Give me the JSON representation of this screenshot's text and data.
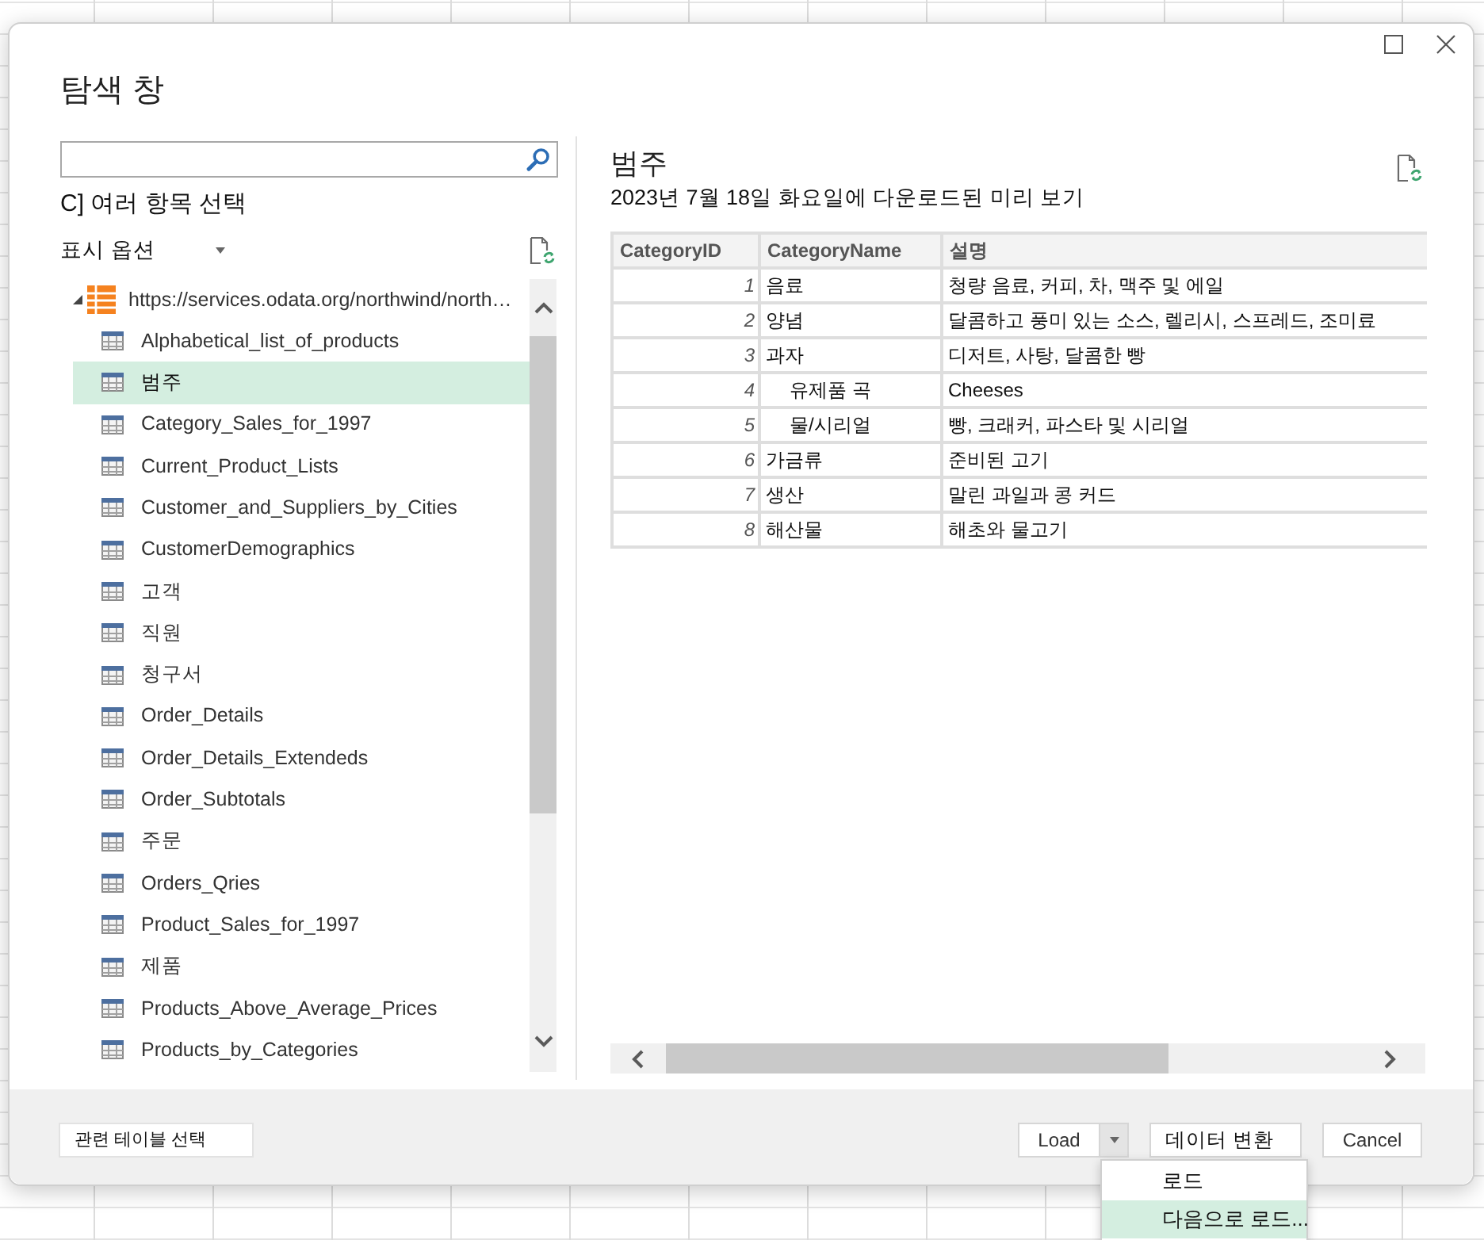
{
  "window": {
    "title": "탐색 창"
  },
  "navigator": {
    "multi_select_label": "C] 여러 항목 선택",
    "display_options": {
      "label": "표시 옵션"
    },
    "tree": {
      "label": "https://services.odata.org/northwind/north…",
      "expanded": true,
      "children": [
        {
          "label": "Alphabetical_list_of_products",
          "selected": false
        },
        {
          "label": "범주",
          "selected": true
        },
        {
          "label": "Category_Sales_for_1997",
          "selected": false
        },
        {
          "label": "Current_Product_Lists",
          "selected": false
        },
        {
          "label": "Customer_and_Suppliers_by_Cities",
          "selected": false
        },
        {
          "label": "CustomerDemographics",
          "selected": false
        },
        {
          "label": "고객",
          "selected": false
        },
        {
          "label": "직원",
          "selected": false
        },
        {
          "label": "청구서",
          "selected": false
        },
        {
          "label": "Order_Details",
          "selected": false
        },
        {
          "label": "Order_Details_Extendeds",
          "selected": false
        },
        {
          "label": "Order_Subtotals",
          "selected": false
        },
        {
          "label": "주문",
          "selected": false
        },
        {
          "label": "Orders_Qries",
          "selected": false
        },
        {
          "label": "Product_Sales_for_1997",
          "selected": false
        },
        {
          "label": "제품",
          "selected": false
        },
        {
          "label": "Products_Above_Average_Prices",
          "selected": false
        },
        {
          "label": "Products_by_Categories",
          "selected": false
        }
      ]
    }
  },
  "preview": {
    "title": "범주",
    "subtitle": "2023년 7월 18일 화요일에 다운로드된 미리 보기",
    "table": {
      "columns": [
        "CategoryID",
        "CategoryName",
        "설명"
      ],
      "rows": [
        {
          "cells": [
            "1",
            "음료",
            "청량 음료, 커피, 차, 맥주 및 에일"
          ],
          "indented": false
        },
        {
          "cells": [
            "2",
            "양념",
            "달콤하고 풍미 있는 소스, 렐리시, 스프레드, 조미료"
          ],
          "indented": false
        },
        {
          "cells": [
            "3",
            "과자",
            "디저트, 사탕, 달콤한 빵"
          ],
          "indented": false
        },
        {
          "cells": [
            "4",
            "유제품 곡",
            "Cheeses"
          ],
          "indented": true
        },
        {
          "cells": [
            "5",
            "물/시리얼",
            "빵, 크래커, 파스타 및 시리얼"
          ],
          "indented": true
        },
        {
          "cells": [
            "6",
            "가금류",
            "준비된 고기"
          ],
          "indented": false
        },
        {
          "cells": [
            "7",
            "생산",
            "말린 과일과 콩 커드"
          ],
          "indented": false
        },
        {
          "cells": [
            "8",
            "해산물",
            "해초와 물고기"
          ],
          "indented": false
        }
      ]
    }
  },
  "footer": {
    "select_related_button": "관련 테이블 선택",
    "load_button": {
      "label": "Load",
      "menu_expanded": true
    },
    "transform_button": "데이터 변환",
    "cancel_button": "Cancel"
  },
  "load_menu": {
    "items": [
      {
        "label": "로드",
        "selected": false
      },
      {
        "label": "다음으로 로드...",
        "selected": true
      }
    ]
  }
}
